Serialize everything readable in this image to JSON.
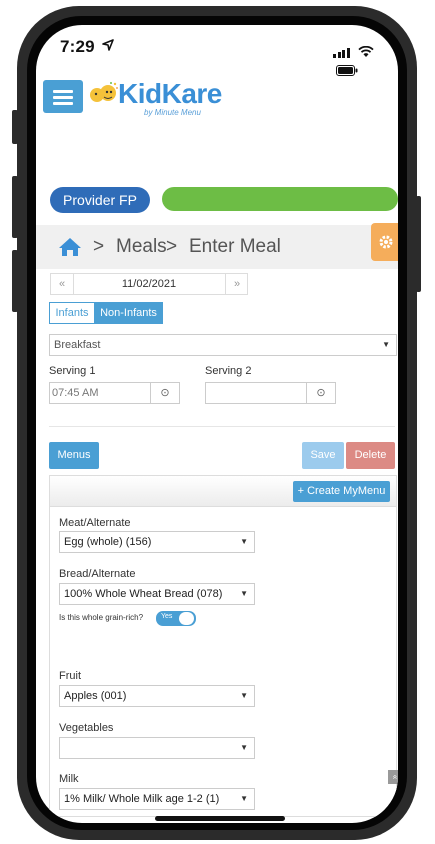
{
  "status": {
    "time": "7:29",
    "location_icon": "location-arrow-icon"
  },
  "header": {
    "logo_text": "KidKare",
    "logo_sub": "by Minute Menu"
  },
  "provider": {
    "label": "Provider FP"
  },
  "breadcrumb": {
    "items": [
      "Meals",
      "Enter Meal"
    ],
    "separator": ">"
  },
  "date": {
    "prev": "«",
    "value": "11/02/2021",
    "next": "»"
  },
  "tabs": [
    {
      "label": "Infants",
      "active": false
    },
    {
      "label": "Non-Infants",
      "active": true
    }
  ],
  "meal": {
    "selected": "Breakfast"
  },
  "serving1": {
    "label": "Serving 1",
    "value": "07:45 AM"
  },
  "serving2": {
    "label": "Serving 2",
    "value": ""
  },
  "buttons": {
    "menus": "Menus",
    "save": "Save",
    "delete": "Delete",
    "create_menu": "+ Create MyMenu"
  },
  "fields": {
    "meat": {
      "label": "Meat/Alternate",
      "value": "Egg (whole) (156)"
    },
    "bread": {
      "label": "Bread/Alternate",
      "value": "100% Whole Wheat Bread (078)"
    },
    "grain_question": "Is this whole grain-rich?",
    "grain_toggle": "Yes",
    "fruit": {
      "label": "Fruit",
      "value": "Apples (001)"
    },
    "vegetables": {
      "label": "Vegetables",
      "value": ""
    },
    "milk": {
      "label": "Milk",
      "value": "1% Milk/ Whole Milk age 1-2 (1)"
    }
  },
  "scroll_top": "»",
  "colors": {
    "primary": "#4a9fd4",
    "provider": "#2f6cb8",
    "green": "#6dbd45",
    "orange": "#f5ad5b",
    "delete": "#dc8a84",
    "save": "#9ccbed"
  }
}
